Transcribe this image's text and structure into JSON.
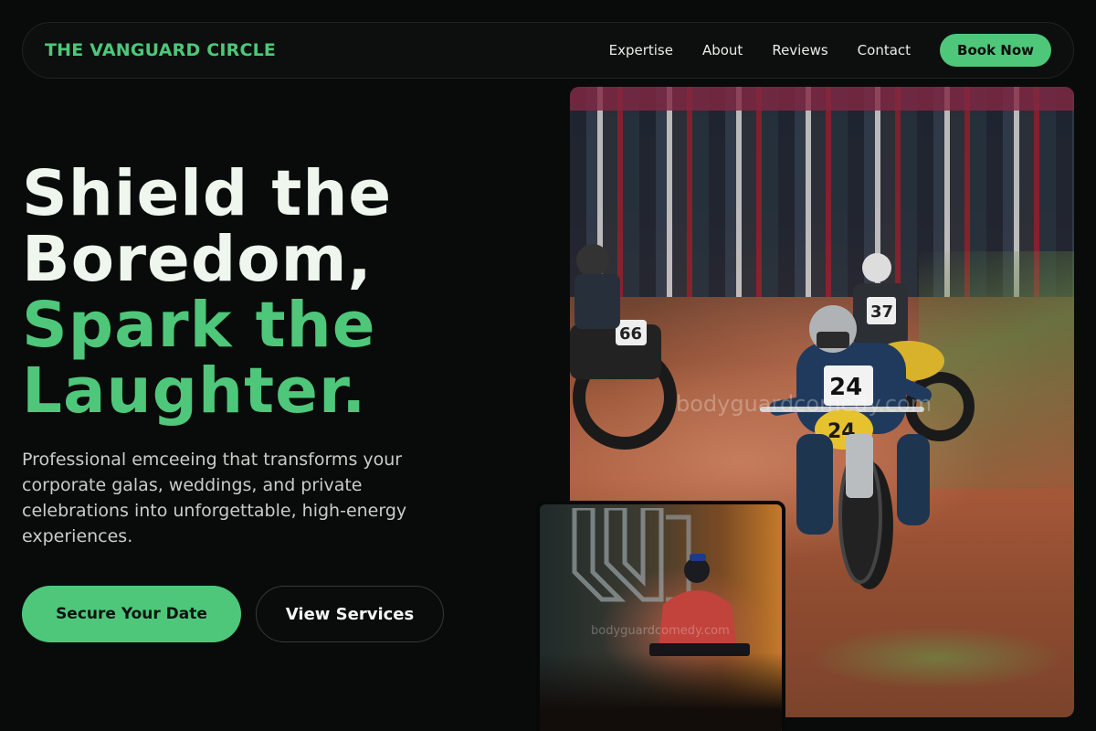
{
  "nav": {
    "brand": "THE VANGUARD CIRCLE",
    "links": [
      "Expertise",
      "About",
      "Reviews",
      "Contact"
    ],
    "cta": "Book Now"
  },
  "hero": {
    "title_lines": [
      "Shield the",
      "Boredom,",
      "Spark the",
      "Laughter."
    ],
    "subtitle": "Professional emceeing that transforms your corporate galas, weddings, and private celebrations into unforgettable, high-energy experiences.",
    "primary_cta": "Secure Your Date",
    "secondary_cta": "View Services"
  },
  "images": {
    "main_watermark": "bodyguardcomedy.com",
    "inset_watermark": "bodyguardcomedy.com",
    "main_bib_number": "24",
    "bg_rider_bib_1": "66",
    "bg_rider_bib_2": "37"
  },
  "colors": {
    "accent": "#4ec77a",
    "background": "#090b0a"
  }
}
